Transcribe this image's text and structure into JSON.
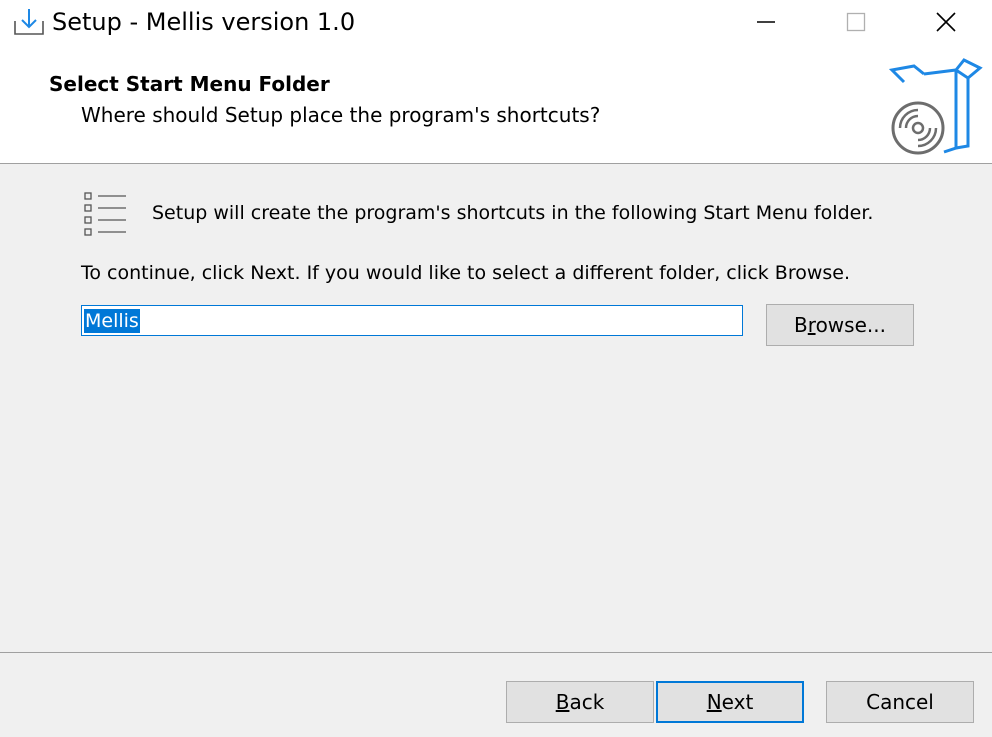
{
  "window": {
    "title": "Setup - Mellis version 1.0",
    "minimize_icon": "minimize-icon",
    "maximize_icon": "maximize-icon",
    "close_icon": "close-icon"
  },
  "header": {
    "title": "Select Start Menu Folder",
    "subtitle": "Where should Setup place the program's shortcuts?",
    "art_icon": "software-box-disc-icon"
  },
  "body": {
    "intro": "Setup will create the program's shortcuts in the following Start Menu folder.",
    "instruction": "To continue, click Next. If you would like to select a different folder, click Browse.",
    "folder_value": "Mellis",
    "browse_button": {
      "prefix": "B",
      "mnemonic": "r",
      "suffix": "owse..."
    }
  },
  "footer": {
    "back_button": {
      "mnemonic": "B",
      "suffix": "ack"
    },
    "next_button": {
      "mnemonic": "N",
      "suffix": "ext"
    },
    "cancel_button": "Cancel"
  },
  "colors": {
    "accent": "#0078d7",
    "header_art": "#1e88e5"
  }
}
